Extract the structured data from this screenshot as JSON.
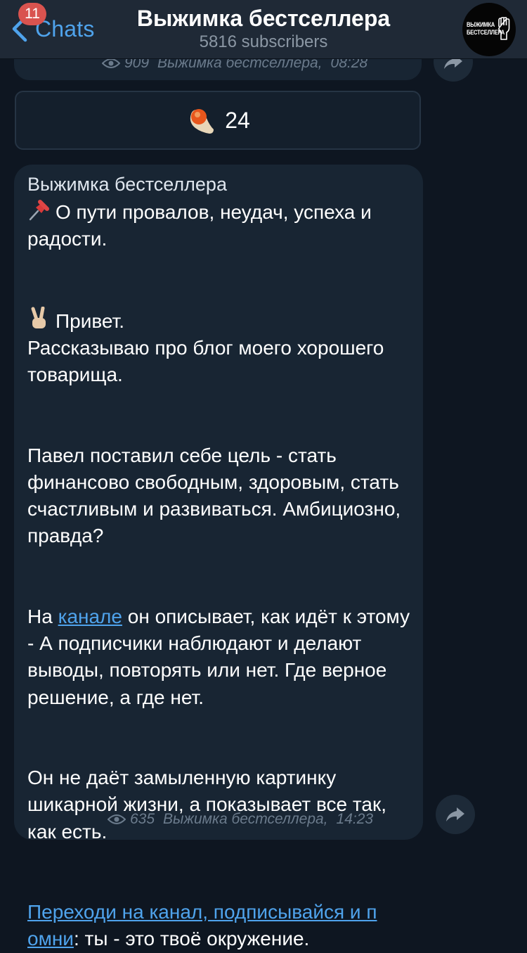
{
  "header": {
    "back_label": "Chats",
    "unread_count": "11",
    "title": "Выжимка бестселлера",
    "subtitle": "5816 subscribers",
    "avatar_text": "ВЫЖИМКА БЕСТСЕЛЛЕРА"
  },
  "prev_post": {
    "views": "909",
    "author": "Выжимка бестселлера,",
    "time": "08:28"
  },
  "reaction": {
    "count": "24"
  },
  "post": {
    "author": "Выжимка бестселлера",
    "p1": "О пути провалов, неудач, успеха и радости.",
    "p2a": "Привет.",
    "p2b": "Рассказываю про блог моего хорошего товарища.",
    "p3": "Павел поставил себе цель - стать финансово свободным, здоровым, стать счастливым и развиваться. Амбициозно, правда?",
    "p4_pre": "На ",
    "p4_link": "канале",
    "p4_post": " он описывает, как идёт к этому - А подписчики наблюдают и делают выводы, повторять или нет. Где верное решение, а где нет.",
    "p5": "Он не даёт замыленную картинку шикарной жизни, а показывает все так, как есть.",
    "p6_link1": "Переходи на канал, подписывайся и п",
    "p6_link2": "омни",
    "p6_post": ": ты - это твоё окружение.",
    "views": "635",
    "meta_author": "Выжимка бестселлера,",
    "time": "14:23"
  },
  "colors": {
    "background": "#0e1621",
    "header": "#1f2936",
    "bubble": "#182533",
    "accent": "#4fa3ec",
    "badge": "#d9534f",
    "meta": "#6b7b8c"
  },
  "icons": [
    "chevron-left-icon",
    "eye-icon",
    "share-icon",
    "fire-reaction-icon",
    "pushpin-icon",
    "victory-hand-icon",
    "raised-fist-icon"
  ]
}
